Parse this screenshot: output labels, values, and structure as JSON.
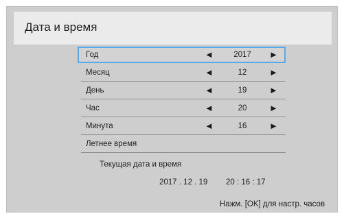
{
  "window": {
    "title": "Дата и время"
  },
  "settings": [
    {
      "label": "Год",
      "value": "2017"
    },
    {
      "label": "Месяц",
      "value": "12"
    },
    {
      "label": "День",
      "value": "19"
    },
    {
      "label": "Час",
      "value": "20"
    },
    {
      "label": "Минута",
      "value": "16"
    }
  ],
  "dst": {
    "label": "Летнее время"
  },
  "arrows": {
    "left": "◄",
    "right": "►"
  },
  "current": {
    "label": "Текущая дата и время",
    "date": "2017 . 12 . 19",
    "time": "20 : 16 : 17"
  },
  "hint": "Нажм. [OK] для настр. часов"
}
